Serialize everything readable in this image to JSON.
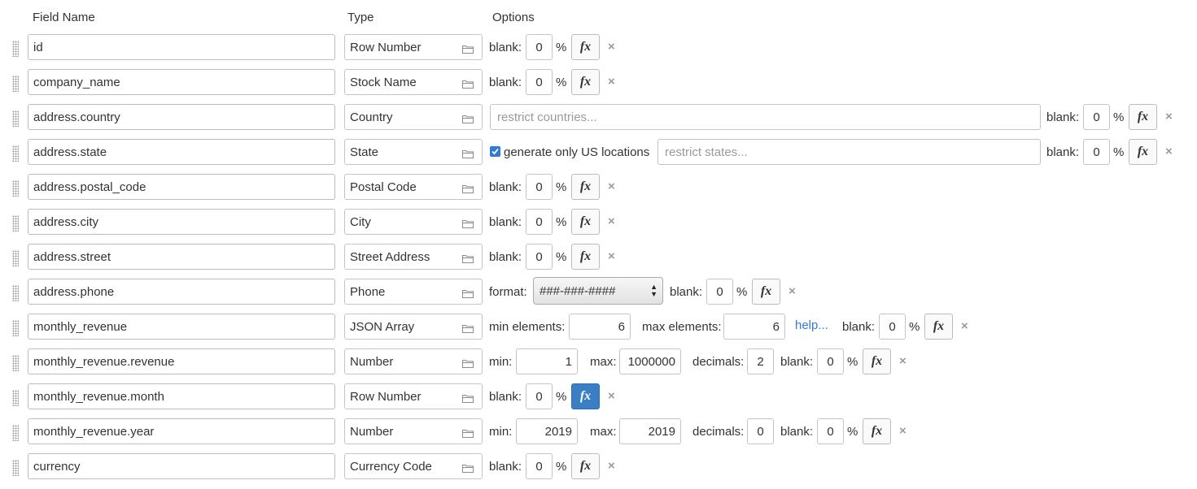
{
  "header": {
    "field_name": "Field Name",
    "type": "Type",
    "options": "Options"
  },
  "labels": {
    "blank": "blank:",
    "percent": "%",
    "fx": "fx",
    "delete": "×",
    "format": "format:",
    "min": "min:",
    "max": "max:",
    "decimals": "decimals:",
    "min_elements": "min elements:",
    "max_elements": "max elements:",
    "help": "help...",
    "generate_us": "generate only US locations"
  },
  "icons": {
    "type_picker": "folder-icon",
    "drag": "drag-handle-icon",
    "formula": "fx-icon",
    "remove": "close-icon"
  },
  "colors": {
    "accent": "#3a7fc3",
    "link": "#2f7bd8",
    "border": "#c4c4c4"
  },
  "rows": [
    {
      "name": "id",
      "type": "Row Number",
      "blank": "0"
    },
    {
      "name": "company_name",
      "type": "Stock Name",
      "blank": "0"
    },
    {
      "name": "address.country",
      "type": "Country",
      "blank": "0",
      "restrict_placeholder": "restrict countries..."
    },
    {
      "name": "address.state",
      "type": "State",
      "blank": "0",
      "generate_us_checked": true,
      "restrict_placeholder": "restrict states..."
    },
    {
      "name": "address.postal_code",
      "type": "Postal Code",
      "blank": "0"
    },
    {
      "name": "address.city",
      "type": "City",
      "blank": "0"
    },
    {
      "name": "address.street",
      "type": "Street Address",
      "blank": "0"
    },
    {
      "name": "address.phone",
      "type": "Phone",
      "blank": "0",
      "format": "###-###-####"
    },
    {
      "name": "monthly_revenue",
      "type": "JSON Array",
      "blank": "0",
      "min_elements": "6",
      "max_elements": "6"
    },
    {
      "name": "monthly_revenue.revenue",
      "type": "Number",
      "blank": "0",
      "min": "1",
      "max": "1000000",
      "decimals": "2"
    },
    {
      "name": "monthly_revenue.month",
      "type": "Row Number",
      "blank": "0",
      "fx_active": true
    },
    {
      "name": "monthly_revenue.year",
      "type": "Number",
      "blank": "0",
      "min": "2019",
      "max": "2019",
      "decimals": "0"
    },
    {
      "name": "currency",
      "type": "Currency Code",
      "blank": "0"
    }
  ]
}
